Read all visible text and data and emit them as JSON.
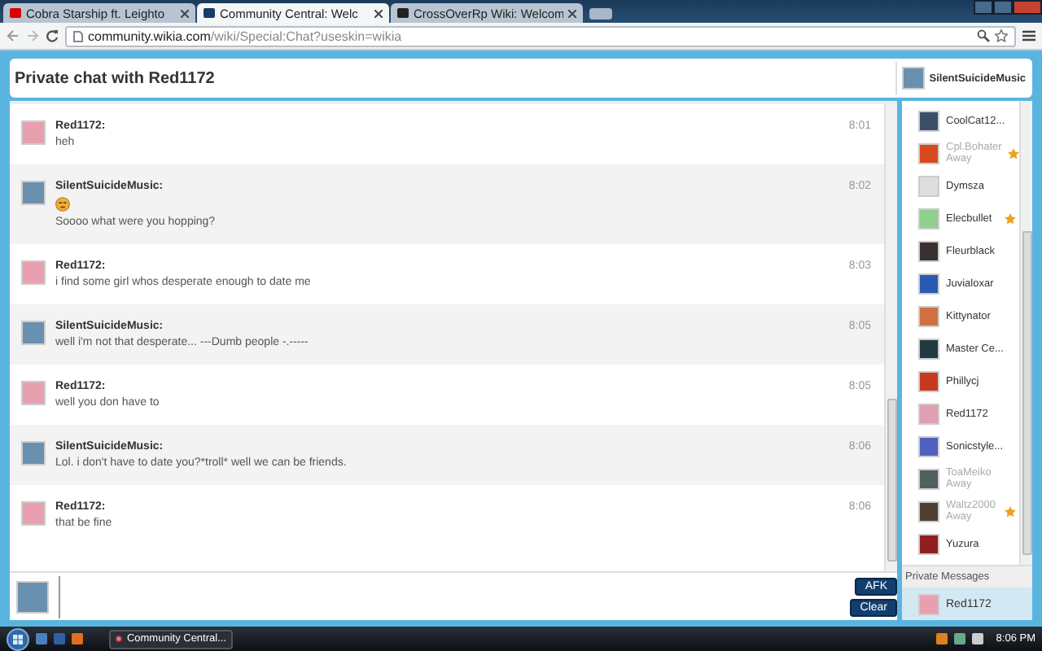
{
  "browser_tabs": [
    {
      "title": "Cobra Starship ft. Leighto",
      "selected": false
    },
    {
      "title": "Community Central: Welc",
      "selected": true
    },
    {
      "title": "CrossOverRp Wiki: Welcom",
      "selected": false
    }
  ],
  "address_bar": {
    "host": "community.wikia.com",
    "path": "/wiki/Special:Chat?useskin=wikia"
  },
  "header": {
    "title": "Private chat with Red1172",
    "user": "SilentSuicideMusic"
  },
  "messages": [
    {
      "author": "Red1172:",
      "color": "#e8a0b0",
      "emoji": false,
      "text": "heh",
      "time": "8:01"
    },
    {
      "author": "SilentSuicideMusic:",
      "color": "#6a90b0",
      "emoji": true,
      "text": "Soooo what were you hopping?",
      "time": "8:02"
    },
    {
      "author": "Red1172:",
      "color": "#e8a0b0",
      "emoji": false,
      "text": "i find some girl whos desperate enough to date me",
      "time": "8:03"
    },
    {
      "author": "SilentSuicideMusic:",
      "color": "#6a90b0",
      "emoji": false,
      "text": "well i'm not that desperate... ---Dumb people -.-----",
      "time": "8:05"
    },
    {
      "author": "Red1172:",
      "color": "#e8a0b0",
      "emoji": false,
      "text": "well you don have to",
      "time": "8:05"
    },
    {
      "author": "SilentSuicideMusic:",
      "color": "#6a90b0",
      "emoji": false,
      "text": "Lol. i don't have to date you?*troll* well we can be friends.",
      "time": "8:06"
    },
    {
      "author": "Red1172:",
      "color": "#e8a0b0",
      "emoji": false,
      "text": "that be fine",
      "time": "8:06"
    }
  ],
  "users": [
    {
      "name": "CoolCat12...",
      "color": "#3a4f6a",
      "away": false,
      "starred": false
    },
    {
      "name": "Cpl.Bohater",
      "status": "Away",
      "color": "#d84a20",
      "away": true,
      "starred": true
    },
    {
      "name": "Dymsza",
      "color": "#dddddd",
      "away": false,
      "starred": false
    },
    {
      "name": "Elecbullet",
      "color": "#8fd08f",
      "away": false,
      "starred": true
    },
    {
      "name": "Fleurblack",
      "color": "#3a3030",
      "away": false,
      "starred": false
    },
    {
      "name": "Juvialoxar",
      "color": "#2a5ab0",
      "away": false,
      "starred": false
    },
    {
      "name": "Kittynator",
      "color": "#d07040",
      "away": false,
      "starred": false
    },
    {
      "name": "Master Ce...",
      "color": "#203a40",
      "away": false,
      "starred": false
    },
    {
      "name": "Phillycj",
      "color": "#c83a20",
      "away": false,
      "starred": false
    },
    {
      "name": "Red1172",
      "color": "#e0a0b0",
      "away": false,
      "starred": false
    },
    {
      "name": "Sonicstyle...",
      "color": "#5060c0",
      "away": false,
      "starred": false
    },
    {
      "name": "ToaMeiko",
      "status": "Away",
      "color": "#506060",
      "away": true,
      "starred": false
    },
    {
      "name": "Waltz2000",
      "status": "Away",
      "color": "#504030",
      "away": true,
      "starred": true
    },
    {
      "name": "Yuzura",
      "color": "#902020",
      "away": false,
      "starred": false
    }
  ],
  "private_messages": {
    "heading": "Private Messages",
    "items": [
      {
        "name": "Red1172",
        "selected": true
      }
    ]
  },
  "buttons": [
    "AFK",
    "Clear"
  ],
  "taskbar": {
    "task": "Community Central...",
    "clock": "8:06 PM"
  }
}
